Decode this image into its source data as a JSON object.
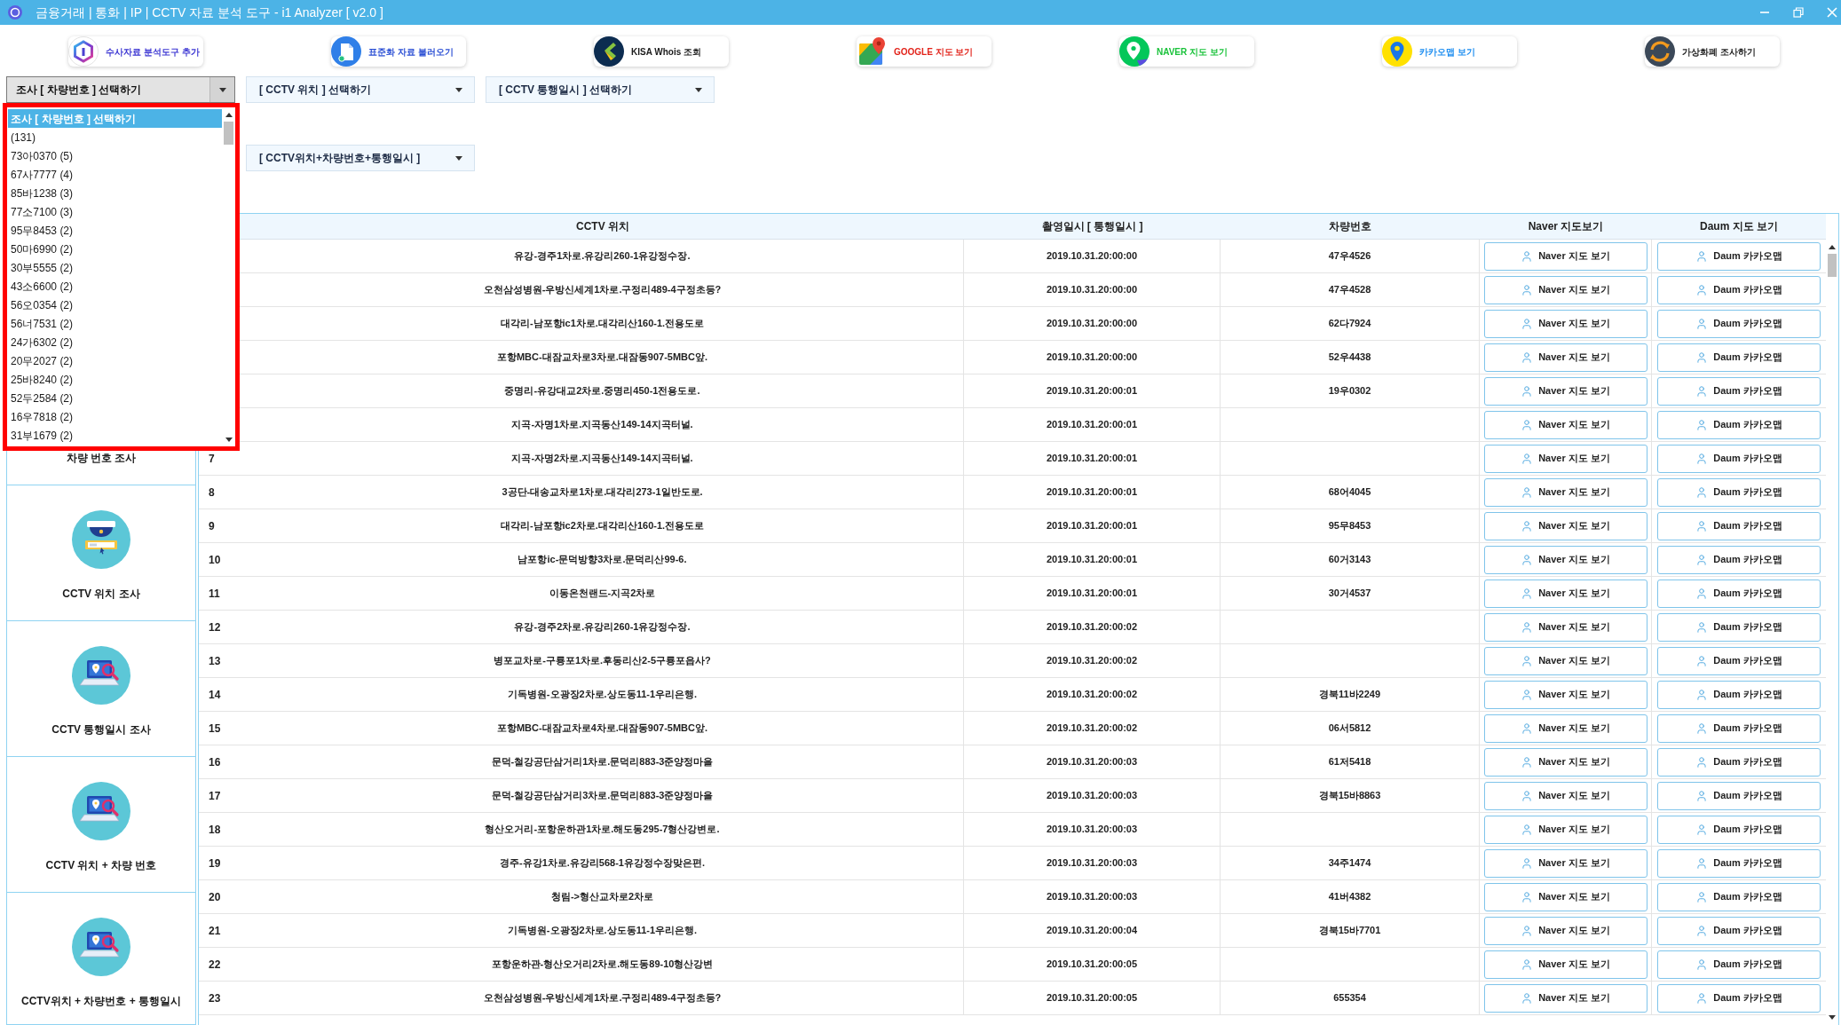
{
  "window": {
    "title": "금융거래 | 통화 | IP | CCTV 자료 분석 도구 - i1 Analyzer [ v2.0 ]"
  },
  "toolbar": [
    {
      "label": "수사자료 분석도구 추가",
      "kind": "logo"
    },
    {
      "label": "표준화 자료 불러오기",
      "kind": "document"
    },
    {
      "label": "KISA Whois 조회",
      "kind": "kisa"
    },
    {
      "label": "GOOGLE 지도 보기",
      "kind": "google"
    },
    {
      "label": "NAVER 지도 보기",
      "kind": "naver"
    },
    {
      "label": "카카오맵 보기",
      "kind": "kakao"
    },
    {
      "label": "가상화폐 조사하기",
      "kind": "crypto"
    }
  ],
  "filter_rows": [
    [
      {
        "label": "조사 [ 차량번호 ] 선택하기",
        "expanded": true,
        "options": [
          {
            "label": "조사 [ 차량번호 ] 선택하기",
            "selected": true
          },
          {
            "label": "(131)",
            "selected": false
          },
          {
            "label": "73아0370 (5)",
            "selected": false
          },
          {
            "label": "67사7777 (4)",
            "selected": false
          },
          {
            "label": "85바1238 (3)",
            "selected": false
          },
          {
            "label": "77소7100 (3)",
            "selected": false
          },
          {
            "label": "95무8453 (2)",
            "selected": false
          },
          {
            "label": "50마6990 (2)",
            "selected": false
          },
          {
            "label": "30부5555 (2)",
            "selected": false
          },
          {
            "label": "43소6600 (2)",
            "selected": false
          },
          {
            "label": "56오0354 (2)",
            "selected": false
          },
          {
            "label": "56너7531 (2)",
            "selected": false
          },
          {
            "label": "24가6302 (2)",
            "selected": false
          },
          {
            "label": "20무2027 (2)",
            "selected": false
          },
          {
            "label": "25바8240 (2)",
            "selected": false
          },
          {
            "label": "52두2584 (2)",
            "selected": false
          },
          {
            "label": "16우7818 (2)",
            "selected": false
          },
          {
            "label": "31부1679 (2)",
            "selected": false
          }
        ]
      },
      {
        "label": "[ CCTV 위치 ] 선택하기",
        "expanded": false
      },
      {
        "label": "[ CCTV 통행일시 ] 선택하기",
        "expanded": false
      }
    ],
    [
      {
        "label": "[ CCTV위치+차량번호+통행일시 ]",
        "expanded": false
      }
    ]
  ],
  "sidebar": {
    "items": [
      {
        "label": "차량 번호 조사",
        "kind": "text"
      },
      {
        "label": "CCTV 위치 조사",
        "kind": "camera"
      },
      {
        "label": "CCTV 통행일시 조사",
        "kind": "laptop"
      },
      {
        "label": "CCTV 위치 + 차량 번호",
        "kind": "laptop"
      },
      {
        "label": "CCTV위치 + 차량번호 + 통행일시",
        "kind": "laptop"
      }
    ]
  },
  "table": {
    "columns": [
      "CCTV 위치",
      "촬영일시 [ 통행일시 ]",
      "차량번호",
      "Naver 지도보기",
      "Daum 지도 보기"
    ],
    "rows": [
      {
        "location": "유강-경주1차로.유강리260-1유강정수장.",
        "time": "2019.10.31.20:00:00",
        "plate": "47우4526",
        "naver_button": "Naver 지도 보기",
        "daum_button": "Daum 카카오맵"
      },
      {
        "location": "오천삼성병원-우방신세계1차로.구정리489-4구정초등?",
        "time": "2019.10.31.20:00:00",
        "plate": "47우4528",
        "naver_button": "Naver 지도 보기",
        "daum_button": "Daum 카카오맵"
      },
      {
        "location": "대각리-남포항ic1차로.대각리산160-1.전용도로",
        "time": "2019.10.31.20:00:00",
        "plate": "62다7924",
        "naver_button": "Naver 지도 보기",
        "daum_button": "Daum 카카오맵"
      },
      {
        "location": "포항MBC-대잠교차로3차로.대잠동907-5MBC앞.",
        "time": "2019.10.31.20:00:00",
        "plate": "52우4438",
        "naver_button": "Naver 지도 보기",
        "daum_button": "Daum 카카오맵"
      },
      {
        "location": "중명리-유강대교2차로.중명리450-1전용도로.",
        "time": "2019.10.31.20:00:01",
        "plate": "19우0302",
        "naver_button": "Naver 지도 보기",
        "daum_button": "Daum 카카오맵"
      },
      {
        "location": "지곡-자명1차로.지곡동산149-14지곡터널.",
        "time": "2019.10.31.20:00:01",
        "naver_button": "Naver 지도 보기",
        "daum_button": "Daum 카카오맵"
      },
      {
        "number": "7",
        "location": "지곡-자명2차로.지곡동산149-14지곡터널.",
        "time": "2019.10.31.20:00:01",
        "naver_button": "Naver 지도 보기",
        "daum_button": "Daum 카카오맵"
      },
      {
        "number": "8",
        "location": "3공단-대송교차로1차로.대각리273-1일반도로.",
        "time": "2019.10.31.20:00:01",
        "plate": "68어4045",
        "naver_button": "Naver 지도 보기",
        "daum_button": "Daum 카카오맵"
      },
      {
        "number": "9",
        "location": "대각리-남포항ic2차로.대각리산160-1.전용도로",
        "time": "2019.10.31.20:00:01",
        "plate": "95무8453",
        "naver_button": "Naver 지도 보기",
        "daum_button": "Daum 카카오맵"
      },
      {
        "number": "10",
        "location": "남포항ic-문덕방향3차로.문덕리산99-6.",
        "time": "2019.10.31.20:00:01",
        "plate": "60거3143",
        "naver_button": "Naver 지도 보기",
        "daum_button": "Daum 카카오맵"
      },
      {
        "number": "11",
        "location": "이동온천랜드-지곡2차로",
        "time": "2019.10.31.20:00:01",
        "plate": "30거4537",
        "naver_button": "Naver 지도 보기",
        "daum_button": "Daum 카카오맵"
      },
      {
        "number": "12",
        "location": "유강-경주2차로.유강리260-1유강정수장.",
        "time": "2019.10.31.20:00:02",
        "naver_button": "Naver 지도 보기",
        "daum_button": "Daum 카카오맵"
      },
      {
        "number": "13",
        "location": "병포교차로-구룡포1차로.후동리산2-5구룡포읍사?",
        "time": "2019.10.31.20:00:02",
        "naver_button": "Naver 지도 보기",
        "daum_button": "Daum 카카오맵"
      },
      {
        "number": "14",
        "location": "기독병원-오광장2차로.상도동11-1우리은행.",
        "time": "2019.10.31.20:00:02",
        "plate": "경북11바2249",
        "naver_button": "Naver 지도 보기",
        "daum_button": "Daum 카카오맵"
      },
      {
        "number": "15",
        "location": "포항MBC-대잠교차로4차로.대잠동907-5MBC앞.",
        "time": "2019.10.31.20:00:02",
        "plate": "06서5812",
        "naver_button": "Naver 지도 보기",
        "daum_button": "Daum 카카오맵"
      },
      {
        "number": "16",
        "location": "문덕-철강공단삼거리1차로.문덕리883-3준양정마을",
        "time": "2019.10.31.20:00:03",
        "plate": "61저5418",
        "naver_button": "Naver 지도 보기",
        "daum_button": "Daum 카카오맵"
      },
      {
        "number": "17",
        "location": "문덕-철강공단삼거리3차로.문덕리883-3준양정마을",
        "time": "2019.10.31.20:00:03",
        "plate": "경북15바8863",
        "naver_button": "Naver 지도 보기",
        "daum_button": "Daum 카카오맵"
      },
      {
        "number": "18",
        "location": "형산오거리-포항운하관1차로.해도동295-7형산강변로.",
        "time": "2019.10.31.20:00:03",
        "naver_button": "Naver 지도 보기",
        "daum_button": "Daum 카카오맵"
      },
      {
        "number": "19",
        "location": "경주-유강1차로.유강리568-1유강정수장맞은편.",
        "time": "2019.10.31.20:00:03",
        "plate": "34주1474",
        "naver_button": "Naver 지도 보기",
        "daum_button": "Daum 카카오맵"
      },
      {
        "number": "20",
        "location": "청림->형산교차로2차로",
        "time": "2019.10.31.20:00:03",
        "plate": "41버4382",
        "naver_button": "Naver 지도 보기",
        "daum_button": "Daum 카카오맵"
      },
      {
        "number": "21",
        "location": "기독병원-오광장2차로.상도동11-1우리은행.",
        "time": "2019.10.31.20:00:04",
        "plate": "경북15바7701",
        "naver_button": "Naver 지도 보기",
        "daum_button": "Daum 카카오맵"
      },
      {
        "number": "22",
        "location": "포항운하관-형산오거리2차로.해도동89-10형산강변",
        "time": "2019.10.31.20:00:05",
        "naver_button": "Naver 지도 보기",
        "daum_button": "Daum 카카오맵"
      },
      {
        "number": "23",
        "location": "오천삼성병원-우방신세계1차로.구정리489-4구정초등?",
        "time": "2019.10.31.20:00:05",
        "plate": "655354",
        "naver_button": "Naver 지도 보기",
        "daum_button": "Daum 카카오맵"
      }
    ]
  }
}
